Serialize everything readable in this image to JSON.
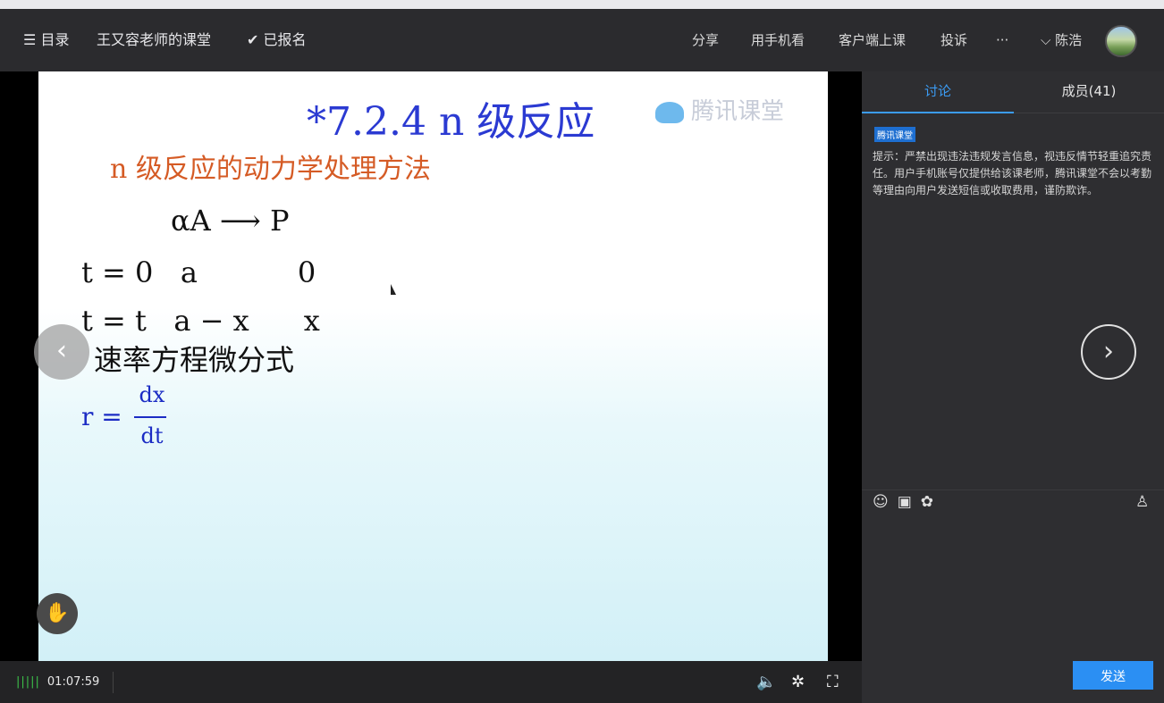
{
  "topbar": {
    "menu_icon": "hamburger-icon",
    "menu_label": "目录",
    "course_title": "王又容老师的课堂",
    "enrolled_icon": "check-icon",
    "enrolled_label": "已报名",
    "share": "分享",
    "mobile": "用手机看",
    "client": "客户端上课",
    "complain": "投诉",
    "more": "···",
    "user_chevron": "⌵",
    "user_name": "陈浩"
  },
  "slide": {
    "title": "*7.2.4   n 级反应",
    "subtitle": "n 级反应的动力学处理方法",
    "watermark": "腾讯课堂",
    "reaction": "αA ⟶ P",
    "row1": "t = 0   a           0",
    "row2": "t = t   a − x      x",
    "rate_label": "速率方程微分式",
    "rate_lhs": "r =",
    "rate_num": "dx",
    "rate_den": "dt"
  },
  "player": {
    "timestamp": "01:07:59",
    "signal": "|||||",
    "volume_icon": "volume-icon",
    "settings_icon": "gear-icon",
    "fullscreen_icon": "fullscreen-icon",
    "prev_icon": "chevron-left-icon",
    "next_icon": "chevron-right-icon",
    "hand_icon": "raise-hand-icon"
  },
  "sidebar": {
    "tab_discussion": "讨论",
    "tab_members": "成员(41)",
    "badge": "腾讯课堂",
    "notice": "提示：严禁出现违法违规发言信息，视违反情节轻重追究责任。用户手机账号仅提供给该课老师，腾讯课堂不会以考勤等理由向用户发送短信或收取费用，谨防欺诈。",
    "send_label": "发送"
  },
  "colors": {
    "accent": "#3b9cf5",
    "slide_title": "#2b3ad2",
    "slide_subtitle": "#d55b25",
    "send_button": "#2b8ff3"
  }
}
